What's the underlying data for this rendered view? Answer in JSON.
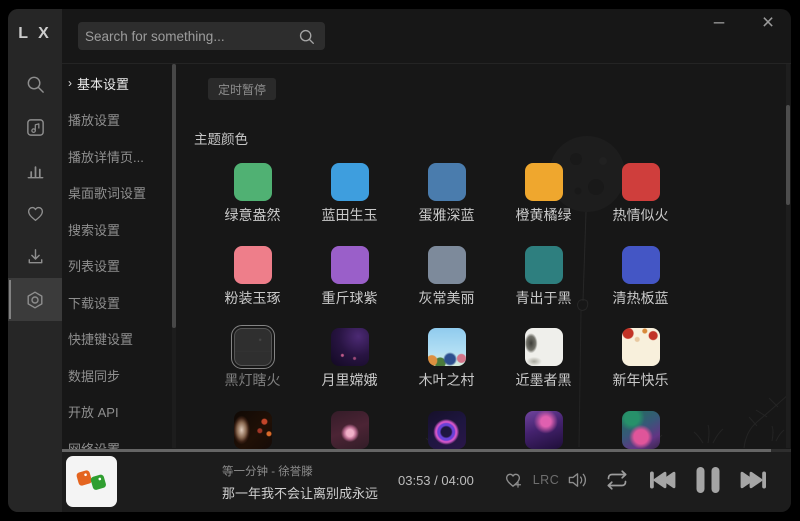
{
  "window": {
    "logo": "L X",
    "minimize_label": "–",
    "close_label": "×"
  },
  "titlebar": {
    "search_placeholder": "Search for something..."
  },
  "sidebar": {
    "items": [
      {
        "icon": "search"
      },
      {
        "icon": "music-library"
      },
      {
        "icon": "leaderboard"
      },
      {
        "icon": "favorites"
      },
      {
        "icon": "download"
      },
      {
        "icon": "settings",
        "active": true
      }
    ]
  },
  "settings_nav": {
    "chevron": "›",
    "items": [
      {
        "label": "基本设置",
        "active": true
      },
      {
        "label": "播放设置"
      },
      {
        "label": "播放详情页..."
      },
      {
        "label": "桌面歌词设置"
      },
      {
        "label": "搜索设置"
      },
      {
        "label": "列表设置"
      },
      {
        "label": "下载设置"
      },
      {
        "label": "快捷键设置"
      },
      {
        "label": "数据同步"
      },
      {
        "label": "开放 API"
      },
      {
        "label": "网络设置"
      }
    ]
  },
  "settings": {
    "timer_pause_button": "定时暂停",
    "theme_section_title": "主题颜色",
    "themes": [
      {
        "name": "绿意盎然",
        "color": "#50b173"
      },
      {
        "name": "蓝田生玉",
        "color": "#3e9ede"
      },
      {
        "name": "蛋雅深蓝",
        "color": "#4a7cad"
      },
      {
        "name": "橙黄橘绿",
        "color": "#efa72e"
      },
      {
        "name": "热情似火",
        "color": "#cf3e3c"
      },
      {
        "name": "粉装玉琢",
        "color": "#ee7e8a"
      },
      {
        "name": "重斤球紫",
        "color": "#9a5fc9"
      },
      {
        "name": "灰常美丽",
        "color": "#7d8a9b"
      },
      {
        "name": "青出于黑",
        "color": "#2e7f7f"
      },
      {
        "name": "清热板蓝",
        "color": "#4456c5"
      },
      {
        "name": "黑灯瞎火",
        "image": "dark",
        "selected": true
      },
      {
        "name": "月里嫦娥",
        "image": "moon-goddess"
      },
      {
        "name": "木叶之村",
        "image": "leaf-village"
      },
      {
        "name": "近墨者黑",
        "image": "ink"
      },
      {
        "name": "新年快乐",
        "image": "new-year"
      },
      {
        "name": "",
        "image": "red-lantern"
      },
      {
        "name": "",
        "image": "pink-emblem"
      },
      {
        "name": "",
        "image": "neon-ring"
      },
      {
        "name": "",
        "image": "violet-glow"
      },
      {
        "name": "",
        "image": "cyber-face"
      }
    ]
  },
  "player": {
    "song": "等一分钟 - 徐誉滕",
    "lyric": "那一年我不会让离别成永远",
    "time": "03:53 / 04:00",
    "lrc_label": "LRC",
    "progress_percent": 97.2
  }
}
